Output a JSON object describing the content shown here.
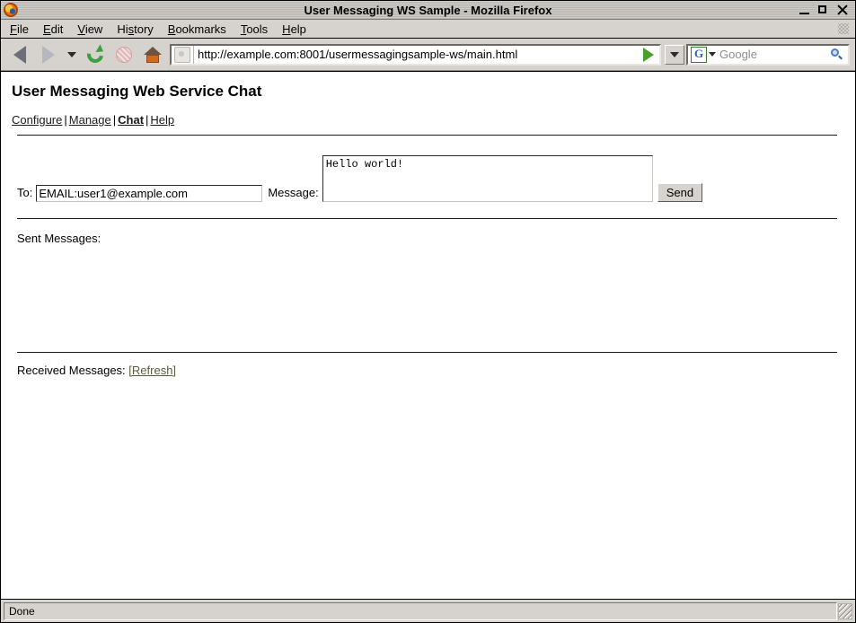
{
  "window": {
    "title": "User Messaging WS Sample - Mozilla Firefox",
    "logo_icon": "firefox-logo-icon",
    "minimize_label": "",
    "maximize_label": "",
    "close_label": ""
  },
  "menubar": {
    "items": [
      {
        "label": "File",
        "mnemonic_before": "",
        "mnemonic": "F",
        "mnemonic_after": "ile"
      },
      {
        "label": "Edit",
        "mnemonic_before": "",
        "mnemonic": "E",
        "mnemonic_after": "dit"
      },
      {
        "label": "View",
        "mnemonic_before": "",
        "mnemonic": "V",
        "mnemonic_after": "iew"
      },
      {
        "label": "History",
        "mnemonic_before": "Hi",
        "mnemonic": "s",
        "mnemonic_after": "tory"
      },
      {
        "label": "Bookmarks",
        "mnemonic_before": "",
        "mnemonic": "B",
        "mnemonic_after": "ookmarks"
      },
      {
        "label": "Tools",
        "mnemonic_before": "",
        "mnemonic": "T",
        "mnemonic_after": "ools"
      },
      {
        "label": "Help",
        "mnemonic_before": "",
        "mnemonic": "H",
        "mnemonic_after": "elp"
      }
    ]
  },
  "toolbar": {
    "back_icon": "back-arrow-icon",
    "forward_icon": "forward-arrow-icon",
    "history_dropdown_icon": "chevron-down-icon",
    "reload_icon": "reload-icon",
    "stop_icon": "stop-icon",
    "home_icon": "home-icon",
    "url": "http://example.com:8001/usermessagingsample-ws/main.html",
    "url_favicon_icon": "page-favicon-icon",
    "go_icon": "go-arrow-icon",
    "url_dropdown_icon": "chevron-down-icon",
    "search_engine_label": "G",
    "search_engine_dropdown_icon": "chevron-down-icon",
    "search_placeholder": "Google",
    "search_value": "",
    "search_icon": "magnifier-icon"
  },
  "page": {
    "title": "User Messaging Web Service Chat",
    "nav": [
      {
        "label": "Configure",
        "current": false
      },
      {
        "label": "Manage",
        "current": false
      },
      {
        "label": "Chat",
        "current": true
      },
      {
        "label": "Help",
        "current": false
      }
    ],
    "nav_separator": "|",
    "form": {
      "to_label": "To:",
      "to_value": "EMAIL:user1@example.com",
      "to_placeholder": "",
      "message_label": "Message:",
      "message_value": "Hello world!",
      "message_placeholder": "",
      "send_label": "Send"
    },
    "sent": {
      "label": "Sent Messages:",
      "items": []
    },
    "received": {
      "label": "Received Messages:",
      "refresh_label": "[Refresh]",
      "items": []
    }
  },
  "statusbar": {
    "text": "Done",
    "resize_grip_icon": "resize-grip-icon"
  }
}
